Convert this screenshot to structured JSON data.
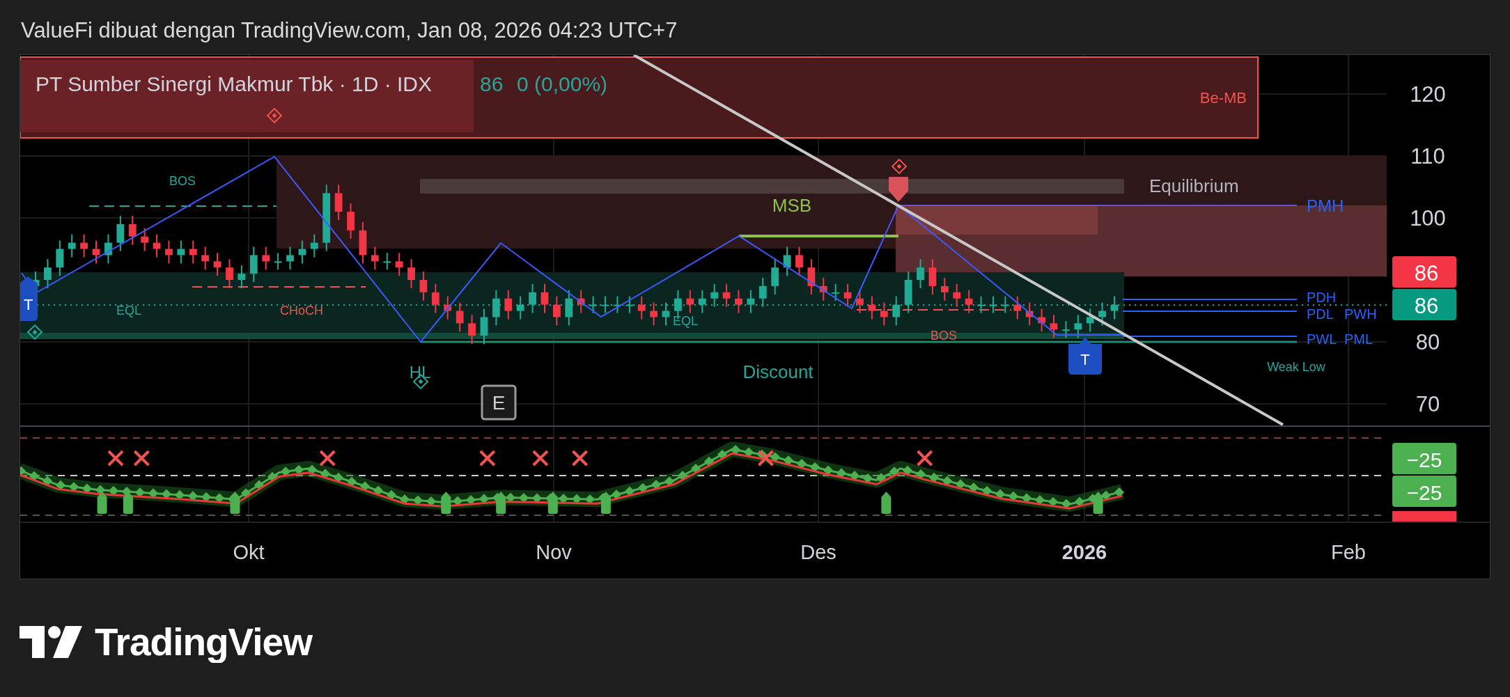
{
  "caption": "ValueFi dibuat dengan TradingView.com, Jan 08, 2026 04:23 UTC+7",
  "legend": {
    "symbol": "PT Sumber Sinergi Makmur Tbk · 1D · IDX",
    "price": "86",
    "change": "0 (0,00%)"
  },
  "price_axis": {
    "ticks": [
      "120",
      "110",
      "100",
      "80",
      "70"
    ],
    "badges": [
      {
        "label": "86",
        "color": "#f23645"
      },
      {
        "label": "86",
        "color": "#089981"
      }
    ]
  },
  "annotations": [
    {
      "text": "BOS",
      "kind": "bullish"
    },
    {
      "text": "EQL",
      "kind": "bullish"
    },
    {
      "text": "CHoCH",
      "kind": "bearish"
    },
    {
      "text": "EQL",
      "kind": "bullish"
    },
    {
      "text": "HL",
      "kind": "bullish"
    },
    {
      "text": "Discount",
      "kind": "bullish"
    },
    {
      "text": "MSB",
      "kind": "msb"
    },
    {
      "text": "BOS",
      "kind": "bearish"
    },
    {
      "text": "Weak Low",
      "kind": "bullish"
    },
    {
      "text": "Equilibrium",
      "kind": "neutral"
    },
    {
      "text": "Be-MB",
      "kind": "bearish"
    },
    {
      "text": "PMH",
      "kind": "level"
    },
    {
      "text": "PDH",
      "kind": "level"
    },
    {
      "text": "PDL",
      "kind": "level"
    },
    {
      "text": "PWH",
      "kind": "level"
    },
    {
      "text": "PWL",
      "kind": "level"
    },
    {
      "text": "PML",
      "kind": "level"
    }
  ],
  "markers": [
    {
      "label": "T",
      "kind": "tag"
    },
    {
      "label": "T",
      "kind": "tag"
    },
    {
      "label": "E",
      "kind": "event"
    }
  ],
  "oscillator": {
    "badges": [
      {
        "label": "−25",
        "color": "#4caf50"
      },
      {
        "label": "−25",
        "color": "#4caf50"
      }
    ]
  },
  "time_axis": [
    {
      "label": "Okt",
      "kind": "month"
    },
    {
      "label": "Nov",
      "kind": "month"
    },
    {
      "label": "Des",
      "kind": "month"
    },
    {
      "label": "2026",
      "kind": "year"
    },
    {
      "label": "Feb",
      "kind": "month"
    }
  ],
  "brand": "TradingView"
}
